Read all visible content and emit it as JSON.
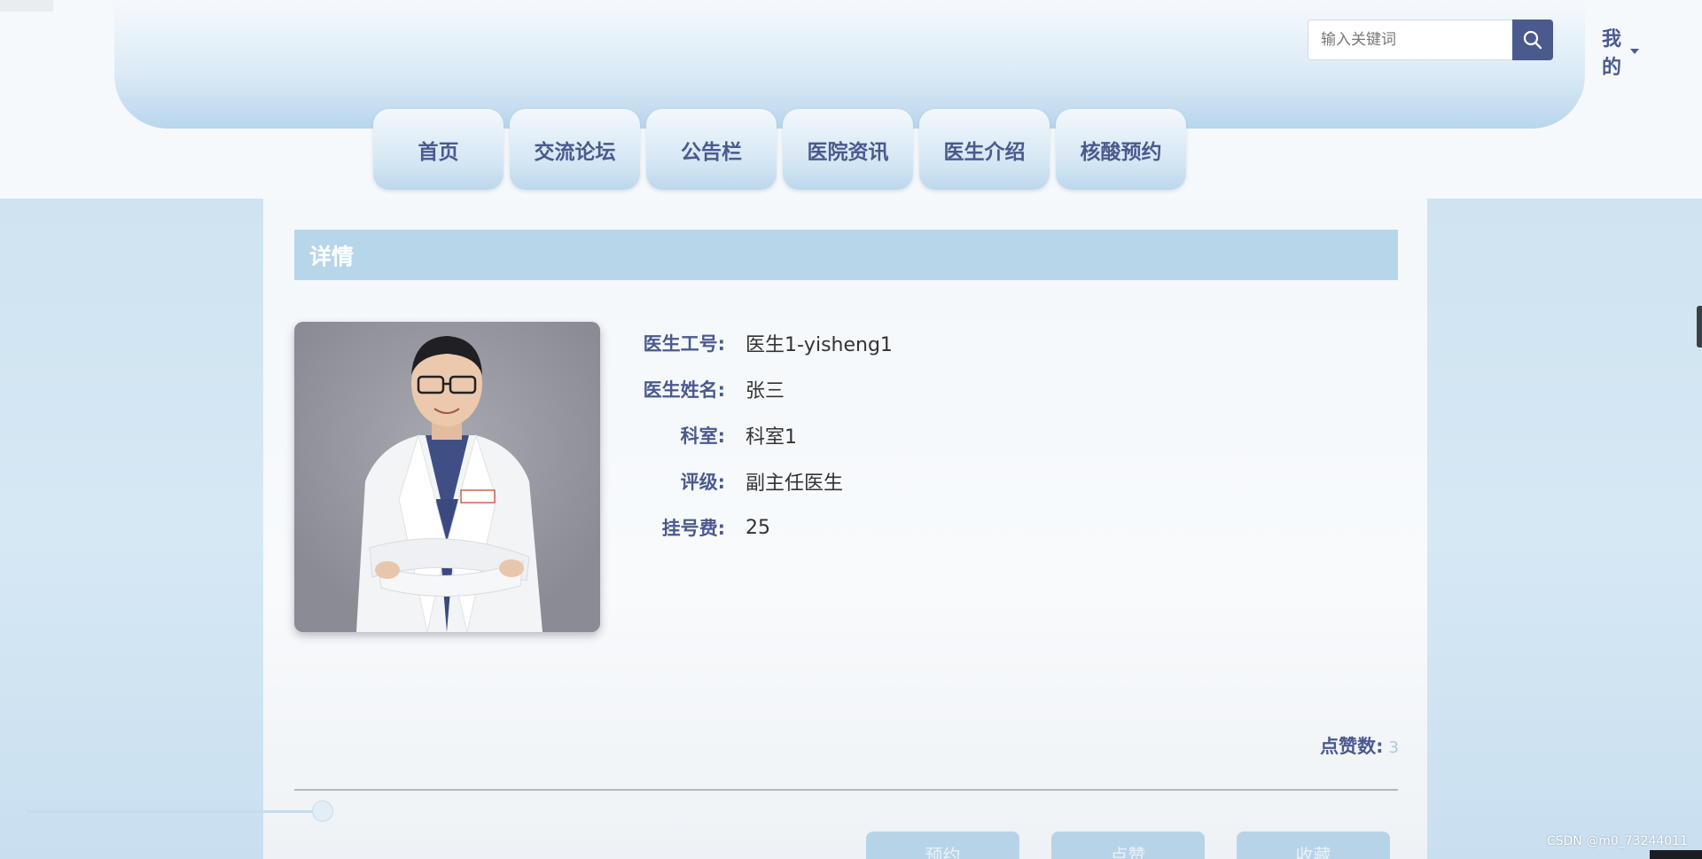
{
  "header": {
    "search": {
      "placeholder": "输入关键词",
      "value": ""
    },
    "user_menu_label": "我的"
  },
  "nav": {
    "items": [
      {
        "label": "首页"
      },
      {
        "label": "交流论坛"
      },
      {
        "label": "公告栏"
      },
      {
        "label": "医院资讯"
      },
      {
        "label": "医生介绍"
      },
      {
        "label": "核酸预约"
      }
    ]
  },
  "detail": {
    "section_title": "详情",
    "fields": [
      {
        "label": "医生工号:",
        "value": "医生1-yisheng1"
      },
      {
        "label": "医生姓名:",
        "value": "张三"
      },
      {
        "label": "科室:",
        "value": "科室1"
      },
      {
        "label": "评级:",
        "value": "副主任医生"
      },
      {
        "label": "挂号费:",
        "value": "25"
      }
    ],
    "likes_label": "点赞数:",
    "likes_value": "3",
    "actions": [
      {
        "label": "预约"
      },
      {
        "label": "点赞"
      },
      {
        "label": "收藏"
      }
    ]
  },
  "watermark": "CSDN @m0_73244011",
  "colors": {
    "accent": "#4a5a8e",
    "section_bar": "#b8d6ea",
    "likes_value": "#a9cbe2"
  }
}
